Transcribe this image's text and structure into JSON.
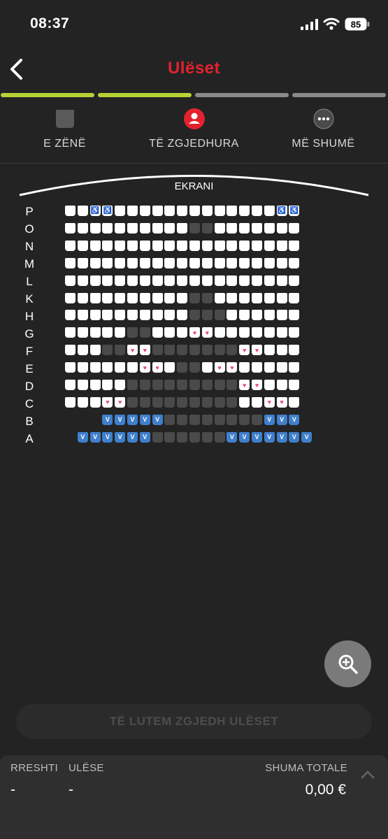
{
  "status_bar": {
    "time": "08:37",
    "battery": "85"
  },
  "header": {
    "title": "Ulëset"
  },
  "progress": {
    "steps_total": 4,
    "steps_done": 2,
    "done_color": "#b5d334",
    "todo_color": "#8a8a8a"
  },
  "tabs": [
    {
      "label": "E ZËNË",
      "icon": "taken-seat-icon"
    },
    {
      "label": "TË ZGJEDHURA",
      "icon": "selected-user-icon"
    },
    {
      "label": "MË SHUMË",
      "icon": "more-dots-icon"
    }
  ],
  "screen_label": "EKRANI",
  "rows": [
    {
      "label": "P",
      "seats": "..ww.............ww"
    },
    {
      "label": "O",
      "seats": "..........xx......."
    },
    {
      "label": "N",
      "seats": "..................."
    },
    {
      "label": "M",
      "seats": "..................."
    },
    {
      "label": "L",
      "seats": "..................."
    },
    {
      "label": "K",
      "seats": "..........xx......."
    },
    {
      "label": "H",
      "seats": "..........xxx......"
    },
    {
      "label": "G",
      "seats": ".....xx...hh......."
    },
    {
      "label": "F",
      "seats": "...xxhhxxxxxxxhh..."
    },
    {
      "label": "E",
      "seats": "......hh.xx.hh....."
    },
    {
      "label": "D",
      "seats": ".....xxxxxxxxxhh..."
    },
    {
      "label": "C",
      "seats": "...hhxxxxxxxxx..hh."
    },
    {
      "label": "B",
      "seats": "   vvvvvxxxxxxxxvvv"
    },
    {
      "label": "A",
      "seats": "  vvvvvvxxxxxxvvvvvvv"
    }
  ],
  "seat_symbols": {
    "vip": "V",
    "sofa": "♥",
    "wheelchair": "♿"
  },
  "cta_label": "TË LUTEM ZGJEDH ULËSET",
  "footer": {
    "row_header": "RRESHTI",
    "row_value": "-",
    "seat_header": "ULËSE",
    "seat_value": "-",
    "total_header": "SHUMA TOTALE",
    "total_value": "0,00 €"
  },
  "colors": {
    "accent": "#e3222f",
    "vip": "#3f7fcc",
    "sofa_heart": "#e8467c"
  }
}
